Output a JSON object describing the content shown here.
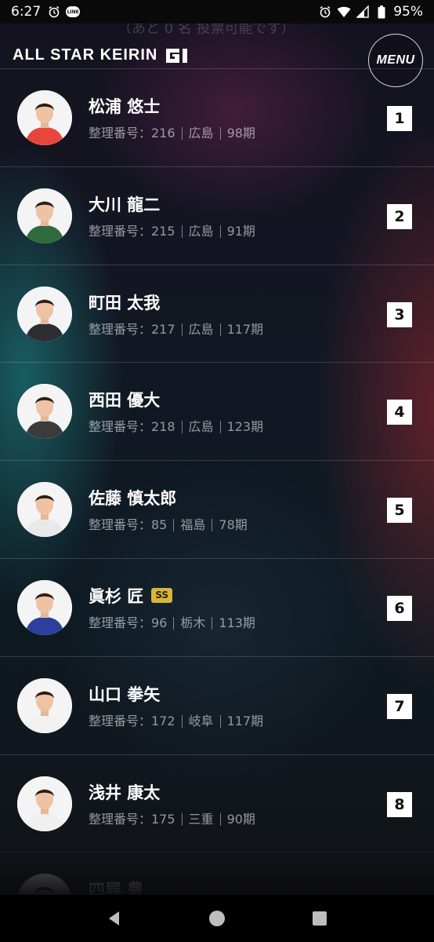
{
  "status_bar": {
    "time": "6:27",
    "line_label": "LINE",
    "battery": "95%"
  },
  "header": {
    "ghost_text": "（あと 0 名 投票可能です）",
    "logo": "ALL STAR KEIRIN",
    "menu_label": "MENU"
  },
  "riders": [
    {
      "name": "松浦 悠士",
      "badge": "",
      "id_label": "整理番号：216",
      "pref": "広島",
      "term": "98期",
      "car": "1",
      "jersey": "#e8453c"
    },
    {
      "name": "大川 龍二",
      "badge": "",
      "id_label": "整理番号：215",
      "pref": "広島",
      "term": "91期",
      "car": "2",
      "jersey": "#2f6b3c"
    },
    {
      "name": "町田 太我",
      "badge": "",
      "id_label": "整理番号：217",
      "pref": "広島",
      "term": "117期",
      "car": "3",
      "jersey": "#2d2d34"
    },
    {
      "name": "西田 優大",
      "badge": "",
      "id_label": "整理番号：218",
      "pref": "広島",
      "term": "123期",
      "car": "4",
      "jersey": "#3b3b3b"
    },
    {
      "name": "佐藤 慎太郎",
      "badge": "",
      "id_label": "整理番号：85",
      "pref": "福島",
      "term": "78期",
      "car": "5",
      "jersey": "#e9e9e9"
    },
    {
      "name": "眞杉 匠",
      "badge": "SS",
      "id_label": "整理番号：96",
      "pref": "栃木",
      "term": "113期",
      "car": "6",
      "jersey": "#2b3f9e"
    },
    {
      "name": "山口 拳矢",
      "badge": "",
      "id_label": "整理番号：172",
      "pref": "岐阜",
      "term": "117期",
      "car": "7",
      "jersey": "#f1f1f1"
    },
    {
      "name": "浅井 康太",
      "badge": "",
      "id_label": "整理番号：175",
      "pref": "三重",
      "term": "90期",
      "car": "8",
      "jersey": "#f0f0f0"
    },
    {
      "name": "四展 豊",
      "badge": "",
      "id_label": "",
      "pref": "",
      "term": "",
      "car": "",
      "jersey": "#444"
    }
  ],
  "nav": {
    "back": "back-icon",
    "home": "home-icon",
    "recents": "recents-icon"
  }
}
